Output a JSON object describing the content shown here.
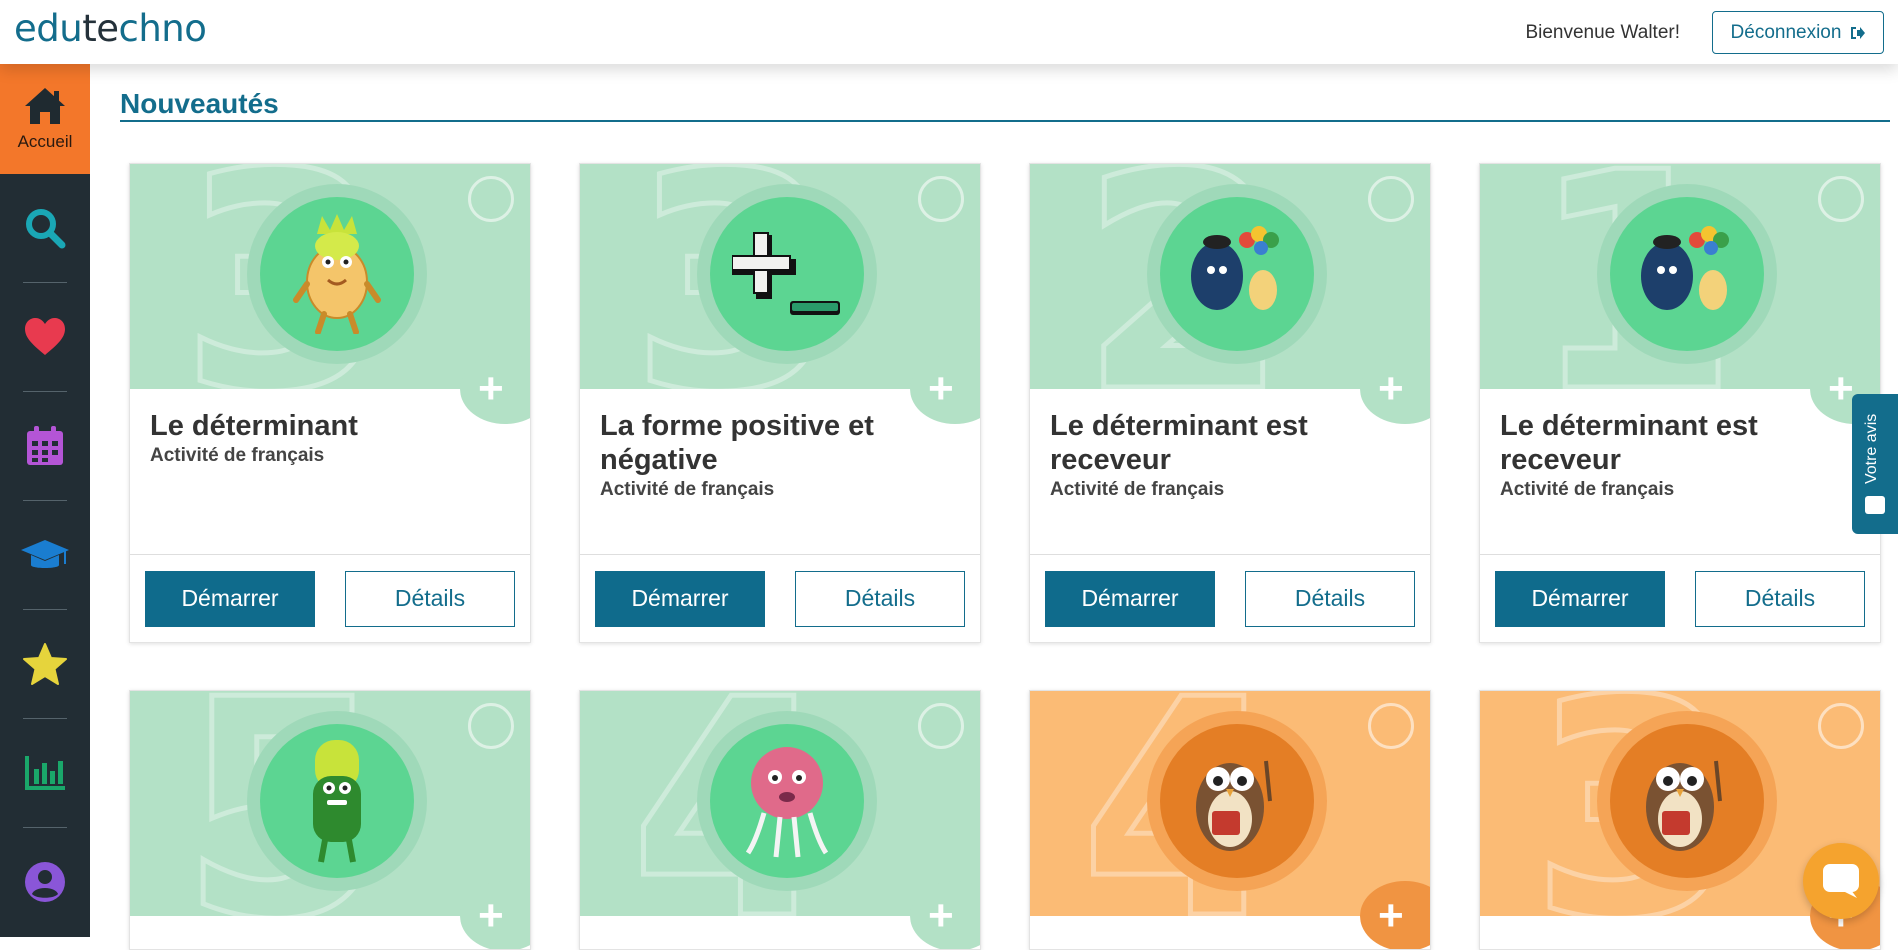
{
  "header": {
    "logo_prefix": "edu",
    "logo_mid": "te",
    "logo_suffix": "chno",
    "welcome": "Bienvenue Walter!",
    "logout_label": "Déconnexion"
  },
  "sidebar": {
    "home_label": "Accueil",
    "items": [
      {
        "icon": "home-icon",
        "color": "#1f2a30"
      },
      {
        "icon": "search-icon",
        "color": "#1aa7b5"
      },
      {
        "icon": "heart-icon",
        "color": "#e83a4f"
      },
      {
        "icon": "calendar-icon",
        "color": "#b455d6"
      },
      {
        "icon": "graduation-cap-icon",
        "color": "#1a7dd0"
      },
      {
        "icon": "star-icon",
        "color": "#e6d43c"
      },
      {
        "icon": "bar-chart-icon",
        "color": "#1aa76a"
      },
      {
        "icon": "user-icon",
        "color": "#8a56d8"
      }
    ]
  },
  "main": {
    "section_title": "Nouveautés",
    "cards": [
      {
        "title": "Le déterminant",
        "subtitle": "Activité de français",
        "start": "Démarrer",
        "details": "Détails",
        "badge_number": "3",
        "theme": "green"
      },
      {
        "title": "La forme positive et négative",
        "subtitle": "Activité de français",
        "start": "Démarrer",
        "details": "Détails",
        "badge_number": "3",
        "theme": "green"
      },
      {
        "title": "Le déterminant est receveur",
        "subtitle": "Activité de français",
        "start": "Démarrer",
        "details": "Détails",
        "badge_number": "2",
        "theme": "green"
      },
      {
        "title": "Le déterminant est receveur",
        "subtitle": "Activité de français",
        "start": "Démarrer",
        "details": "Détails",
        "badge_number": "1",
        "theme": "green"
      },
      {
        "badge_number": "5",
        "theme": "green"
      },
      {
        "badge_number": "4",
        "theme": "green"
      },
      {
        "badge_number": "4",
        "theme": "orange"
      },
      {
        "badge_number": "3",
        "theme": "orange"
      }
    ]
  },
  "feedback": {
    "label": "Votre avis"
  },
  "colors": {
    "primary": "#136d8c",
    "accent": "#f3772a",
    "sidebar": "#222d34"
  }
}
